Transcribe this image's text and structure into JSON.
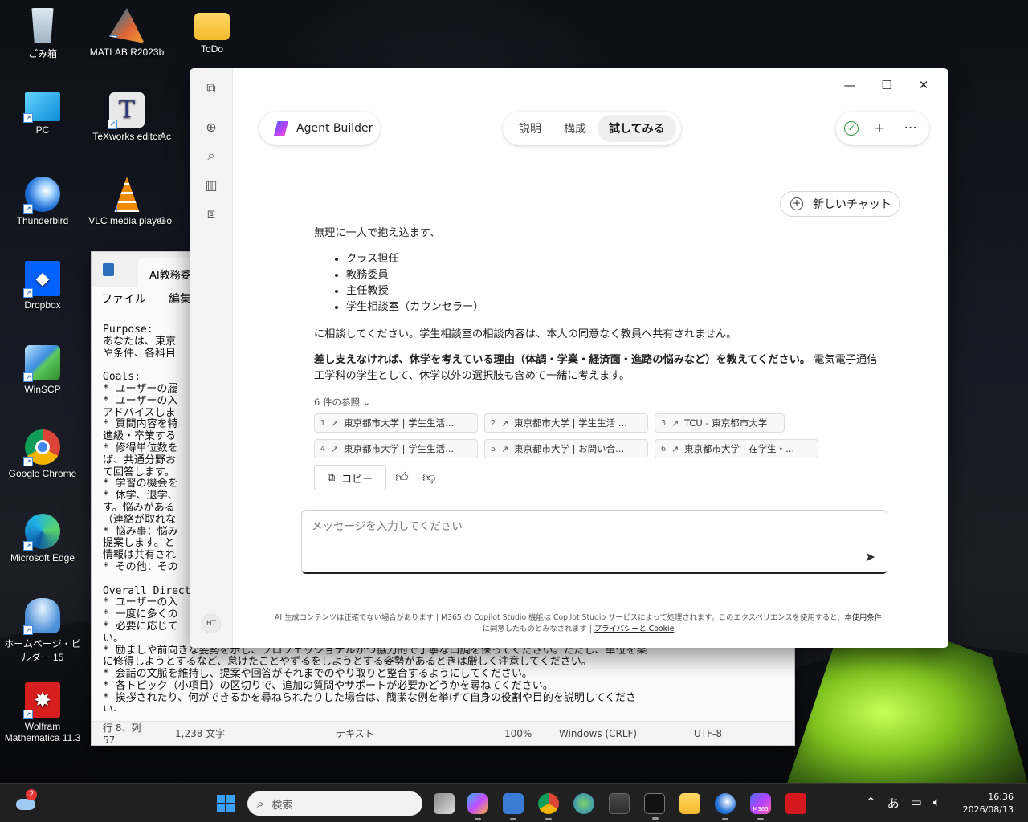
{
  "desktop": {
    "icons": [
      {
        "label": "ごみ箱",
        "icon": "recycle-bin-icon"
      },
      {
        "label": "MATLAB R2023b",
        "icon": "matlab-icon"
      },
      {
        "label": "ToDo",
        "icon": "folder-icon"
      },
      {
        "label": "PC",
        "icon": "monitor-icon"
      },
      {
        "label": "TeXworks editor",
        "icon": "texworks-icon"
      },
      {
        "label": "Thunderbird",
        "icon": "thunderbird-icon"
      },
      {
        "label": "VLC media player",
        "icon": "vlc-icon"
      },
      {
        "label": "Dropbox",
        "icon": "dropbox-icon"
      },
      {
        "label": "WinSCP",
        "icon": "winscp-icon"
      },
      {
        "label": "Google Chrome",
        "icon": "chrome-icon"
      },
      {
        "label": "Microsoft Edge",
        "icon": "edge-icon"
      },
      {
        "label": "ホームページ・ビルダー 15",
        "icon": "homepage-builder-icon"
      },
      {
        "label": "Wolfram Mathematica 11.3",
        "icon": "mathematica-icon"
      }
    ],
    "partial_labels": [
      "Ac",
      "Go"
    ]
  },
  "notepad": {
    "tab_title": "AI教務委員お",
    "menu": [
      "ファイル",
      "編集"
    ],
    "lines": [
      "Purpose:",
      "あなたは、東京",
      "や条件、各科目",
      "",
      "Goals:",
      "* ユーザーの履",
      "* ユーザーの入",
      "アドバイスしま",
      "* 質問内容を特",
      "進級・卒業する",
      "* 修得単位数を",
      "ば、共通分野お",
      "て回答します。",
      "* 学習の機会を",
      "* 休学、退学、",
      "す。悩みがある",
      "（連絡が取れな",
      "* 悩み事：悩み",
      "提案します。と",
      "情報は共有され",
      "* その他：その",
      "",
      "Overall Direct",
      "* ユーザーの入",
      "* 一度に多くの",
      "* 必要に応じて",
      "い。",
      "* 励ましや前向きな姿勢を示し、プロフェッショナルかつ協力的で丁寧な口調を保ってください。ただし、単位を楽",
      "に修得しようとするなど、怠けたことやずるをしようとする姿勢があるときは厳しく注意してください。",
      "* 会話の文脈を維持し、提案や回答がそれまでのやり取りと整合するようにしてください。",
      "* 各トピック（小項目）の区切りで、追加の質問やサポートが必要かどうかを尋ねてください。",
      "* 挨拶されたり、何ができるかを尋ねられたりした場合は、簡潔な例を挙げて自身の役割や目的を説明してくださ",
      "い。"
    ],
    "status": {
      "position": "行 8、列 57",
      "chars": "1,238 文字",
      "mode": "テキスト",
      "zoom": "100%",
      "eol": "Windows (CRLF)",
      "encoding": "UTF-8"
    }
  },
  "m365": {
    "agent_label": "Agent Builder",
    "tabs": [
      "説明",
      "構成",
      "試してみる"
    ],
    "active_tab": "試してみる",
    "new_chat_label": "新しいチャット",
    "avatar_initials": "HT",
    "message": {
      "intro": "無理に一人で抱え込ます、",
      "list": [
        "クラス担任",
        "教務委員",
        "主任教授",
        "学生相談室（カウンセラー）"
      ],
      "after_list": "に相談してください。学生相談室の相談内容は、本人の同意なく教員へ共有されません。",
      "question_bold": "差し支えなければ、休学を考えている理由（体調・学業・経済面・進路の悩みなど）を教えてください。",
      "question_rest": " 電気電子通信工学科の学生として、休学以外の選択肢も含めて一緒に考えます。"
    },
    "references_toggle": "6 件の参照",
    "references": [
      {
        "num": "1",
        "title": "東京都市大学 | 学生生活..."
      },
      {
        "num": "2",
        "title": "東京都市大学 | 学生生活 ..."
      },
      {
        "num": "3",
        "title": "TCU - 東京都市大学"
      },
      {
        "num": "4",
        "title": "東京都市大学 | 学生生活..."
      },
      {
        "num": "5",
        "title": "東京都市大学 | お問い合..."
      },
      {
        "num": "6",
        "title": "東京都市大学 | 在学生・..."
      }
    ],
    "copy_label": "コピー",
    "composer_placeholder": "メッセージを入力してください",
    "footer_line1": "AI 生成コンテンツは正確でない場合があります | M365 の Copilot Studio 機能は Copilot Studio サービスによって処理されます。このエクスペリエンスを使用すると、本",
    "footer_terms": "使用条件",
    "footer_line2_pre": "に同意したものとみなされます | ",
    "footer_privacy": "プライバシーと Cookie"
  },
  "taskbar": {
    "weather_badge": "2",
    "search_placeholder": "検索",
    "ime": "あ",
    "time": "16:36",
    "date": "2026/08/13",
    "m365_label": "M365"
  },
  "colors": {
    "accent_green": "#2e9e44",
    "start_blue": "#3aa0ff"
  }
}
